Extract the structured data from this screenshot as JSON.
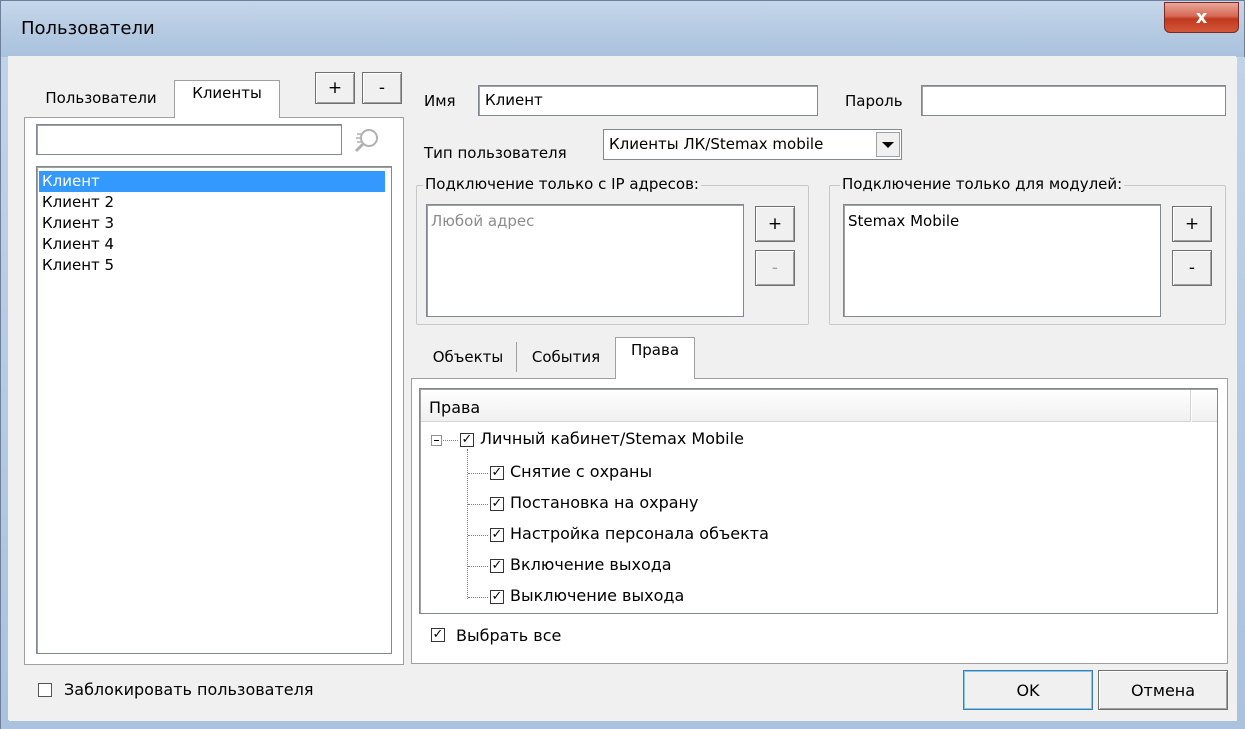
{
  "window": {
    "title": "Пользователи",
    "close_glyph": "x"
  },
  "left_panel": {
    "tabs": [
      {
        "label": "Пользователи",
        "active": false
      },
      {
        "label": "Клиенты",
        "active": true
      }
    ],
    "add_label": "+",
    "remove_label": "-",
    "search": {
      "value": "",
      "placeholder": "",
      "icon": "search-icon"
    },
    "list": [
      {
        "label": "Клиент",
        "selected": true
      },
      {
        "label": "Клиент 2",
        "selected": false
      },
      {
        "label": "Клиент 3",
        "selected": false
      },
      {
        "label": "Клиент 4",
        "selected": false
      },
      {
        "label": "Клиент 5",
        "selected": false
      }
    ],
    "block_user_label": "Заблокировать пользователя",
    "block_user_checked": false
  },
  "form": {
    "name_label": "Имя",
    "name_value": "Клиент",
    "password_label": "Пароль",
    "password_value": "",
    "user_type_label": "Тип пользователя",
    "user_type_value": "Клиенты ЛК/Stemax mobile"
  },
  "ip_group": {
    "label": "Подключение только с IP адресов:",
    "placeholder_item": "Любой адрес",
    "add_label": "+",
    "remove_label": "-"
  },
  "modules_group": {
    "label": "Подключение только для модулей:",
    "items": [
      "Stemax Mobile"
    ],
    "add_label": "+",
    "remove_label": "-"
  },
  "tabs": [
    {
      "label": "Объекты",
      "active": false
    },
    {
      "label": "События",
      "active": false
    },
    {
      "label": "Права",
      "active": true
    }
  ],
  "rights": {
    "column_header": "Права",
    "root": {
      "label": "Личный кабинет/Stemax Mobile",
      "checked": true,
      "expanded": true
    },
    "children": [
      {
        "label": "Снятие с охраны",
        "checked": true
      },
      {
        "label": "Постановка на охрану",
        "checked": true
      },
      {
        "label": "Настройка персонала объекта",
        "checked": true
      },
      {
        "label": "Включение выхода",
        "checked": true
      },
      {
        "label": "Выключение выхода",
        "checked": true
      }
    ],
    "select_all_label": "Выбрать все",
    "select_all_checked": true
  },
  "footer": {
    "ok_label": "OK",
    "cancel_label": "Отмена"
  },
  "colors": {
    "selection": "#3399ff",
    "close_button": "#c0391f",
    "titlebar": "#b9cde4"
  }
}
